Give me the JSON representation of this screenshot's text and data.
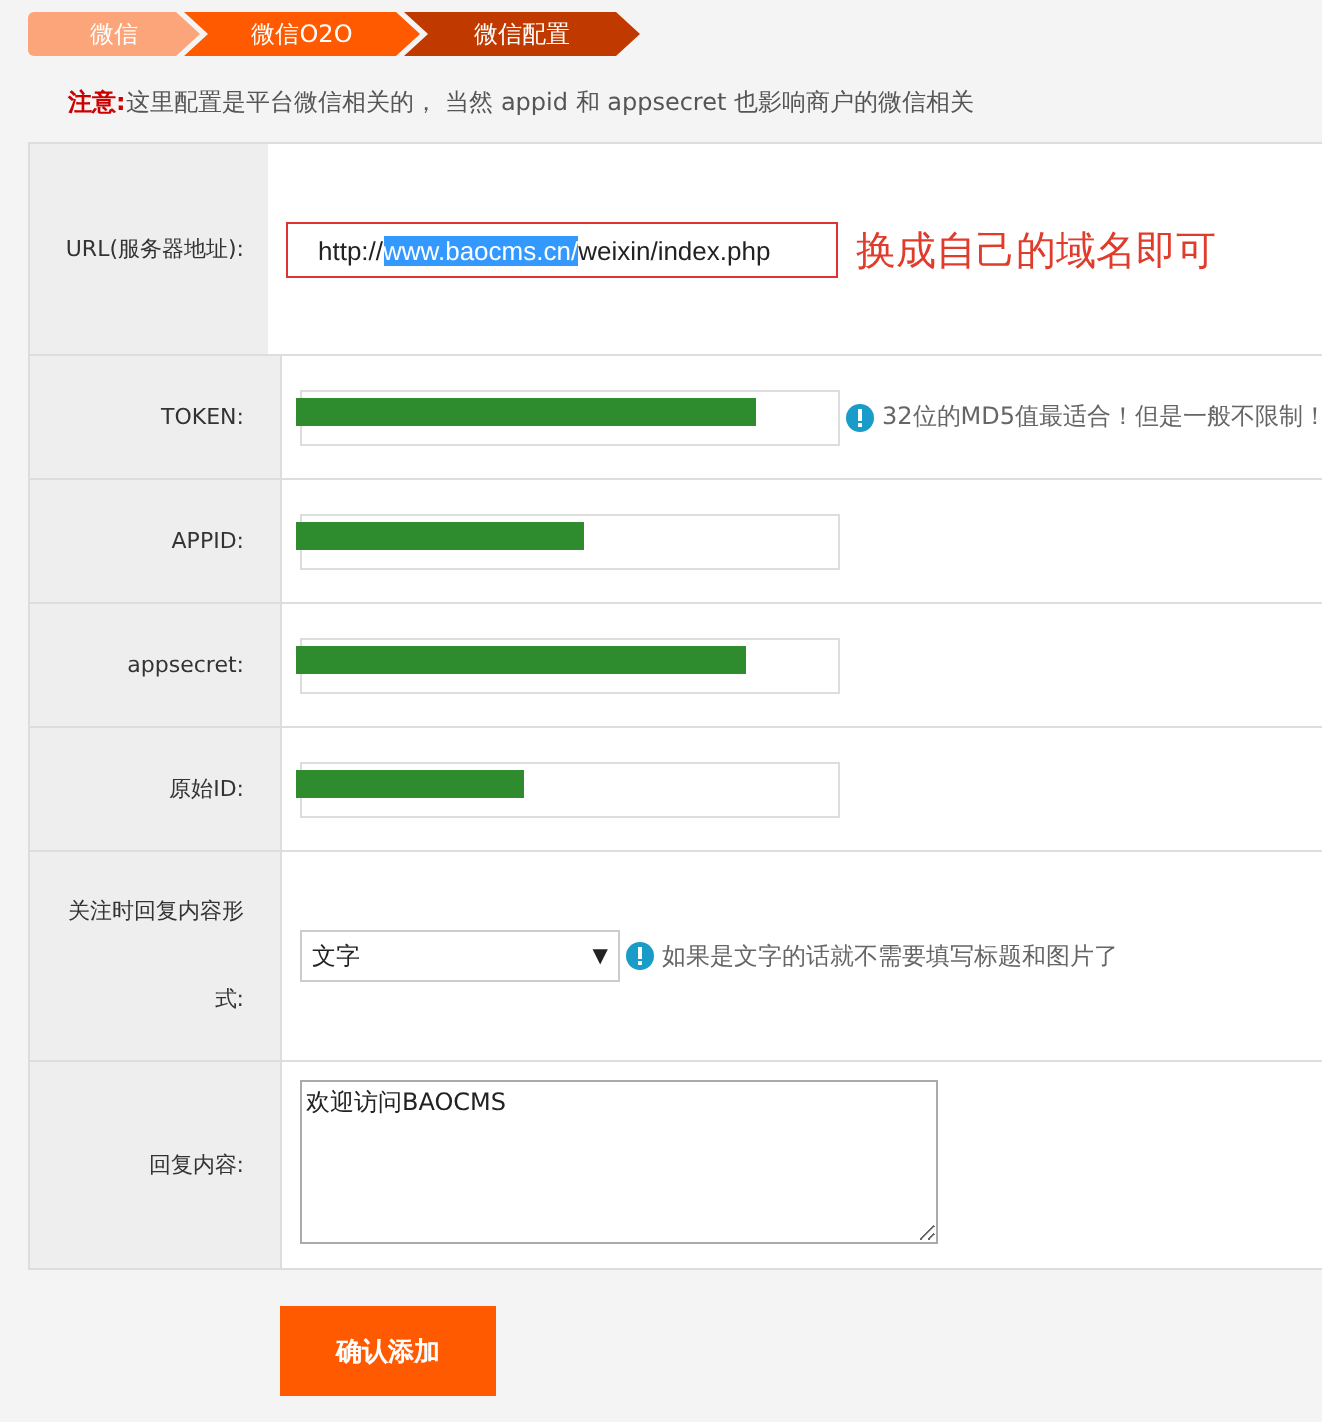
{
  "breadcrumb": [
    {
      "label": "微信",
      "color": "#fca57a"
    },
    {
      "label": "微信O2O",
      "color": "#ff5a00"
    },
    {
      "label": "微信配置",
      "color": "#c03a00"
    }
  ],
  "notice": {
    "label": "注意:",
    "text": "这里配置是平台微信相关的， 当然 appid 和 appsecret 也影响商户的微信相关"
  },
  "rows": [
    {
      "label": "URL(服务器地址):",
      "kind": "url",
      "value_parts": [
        "http://",
        "www.baocms.cn/",
        "weixin/index.php"
      ],
      "annotation": "换成自己的域名即可"
    },
    {
      "label": "TOKEN:",
      "kind": "text",
      "redacted": true,
      "hint": "32位的MD5值最适合！但是一般不限制！"
    },
    {
      "label": "APPID:",
      "kind": "text",
      "redacted": true
    },
    {
      "label": "appsecret:",
      "kind": "text",
      "redacted": true
    },
    {
      "label": "原始ID:",
      "kind": "text",
      "redacted": true
    },
    {
      "label": "关注时回复内容形式:",
      "kind": "select",
      "value": "文字",
      "caret": "▼",
      "hint": "如果是文字的话就不需要填写标题和图片了"
    },
    {
      "label": "回复内容:",
      "kind": "textarea",
      "value": "欢迎访问BAOCMS"
    }
  ],
  "submit": "确认添加"
}
